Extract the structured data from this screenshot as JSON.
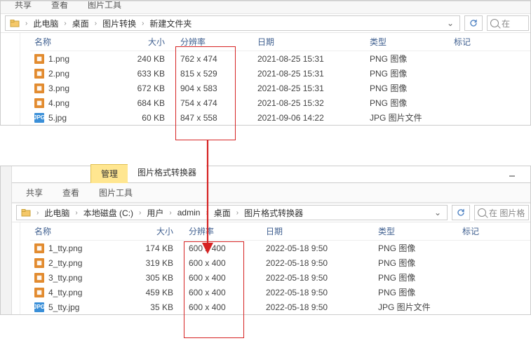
{
  "common": {
    "share": "共享",
    "view": "查看",
    "pic_tools": "图片工具",
    "search_prefix": "在",
    "search_prefix2": "在 图片格"
  },
  "win1": {
    "crumbs": [
      "此电脑",
      "桌面",
      "图片转换",
      "新建文件夹"
    ],
    "headers": {
      "name": "名称",
      "size": "大小",
      "res": "分辨率",
      "date": "日期",
      "type": "类型",
      "mark": "标记"
    },
    "rows": [
      {
        "icon": "png",
        "name": "1.png",
        "size": "240 KB",
        "res": "762 x 474",
        "date": "2021-08-25 15:31",
        "type": "PNG 图像"
      },
      {
        "icon": "png",
        "name": "2.png",
        "size": "633 KB",
        "res": "815 x 529",
        "date": "2021-08-25 15:31",
        "type": "PNG 图像"
      },
      {
        "icon": "png",
        "name": "3.png",
        "size": "672 KB",
        "res": "904 x 583",
        "date": "2021-08-25 15:31",
        "type": "PNG 图像"
      },
      {
        "icon": "png",
        "name": "4.png",
        "size": "684 KB",
        "res": "754 x 474",
        "date": "2021-08-25 15:32",
        "type": "PNG 图像"
      },
      {
        "icon": "jpg",
        "name": "5.jpg",
        "size": "60 KB",
        "res": "847 x 558",
        "date": "2021-09-06 14:22",
        "type": "JPG 图片文件"
      }
    ]
  },
  "win2": {
    "tab_manage": "管理",
    "tab_title": "图片格式转换器",
    "crumbs": [
      "此电脑",
      "本地磁盘 (C:)",
      "用户",
      "admin",
      "桌面",
      "图片格式转换器"
    ],
    "headers": {
      "name": "名称",
      "size": "大小",
      "res": "分辨率",
      "date": "日期",
      "type": "类型",
      "mark": "标记"
    },
    "rows": [
      {
        "icon": "png",
        "name": "1_tty.png",
        "size": "174 KB",
        "res": "600 x 400",
        "date": "2022-05-18 9:50",
        "type": "PNG 图像"
      },
      {
        "icon": "png",
        "name": "2_tty.png",
        "size": "319 KB",
        "res": "600 x 400",
        "date": "2022-05-18 9:50",
        "type": "PNG 图像"
      },
      {
        "icon": "png",
        "name": "3_tty.png",
        "size": "305 KB",
        "res": "600 x 400",
        "date": "2022-05-18 9:50",
        "type": "PNG 图像"
      },
      {
        "icon": "png",
        "name": "4_tty.png",
        "size": "459 KB",
        "res": "600 x 400",
        "date": "2022-05-18 9:50",
        "type": "PNG 图像"
      },
      {
        "icon": "jpg",
        "name": "5_tty.jpg",
        "size": "35 KB",
        "res": "600 x 400",
        "date": "2022-05-18 9:50",
        "type": "JPG 图片文件"
      }
    ]
  }
}
